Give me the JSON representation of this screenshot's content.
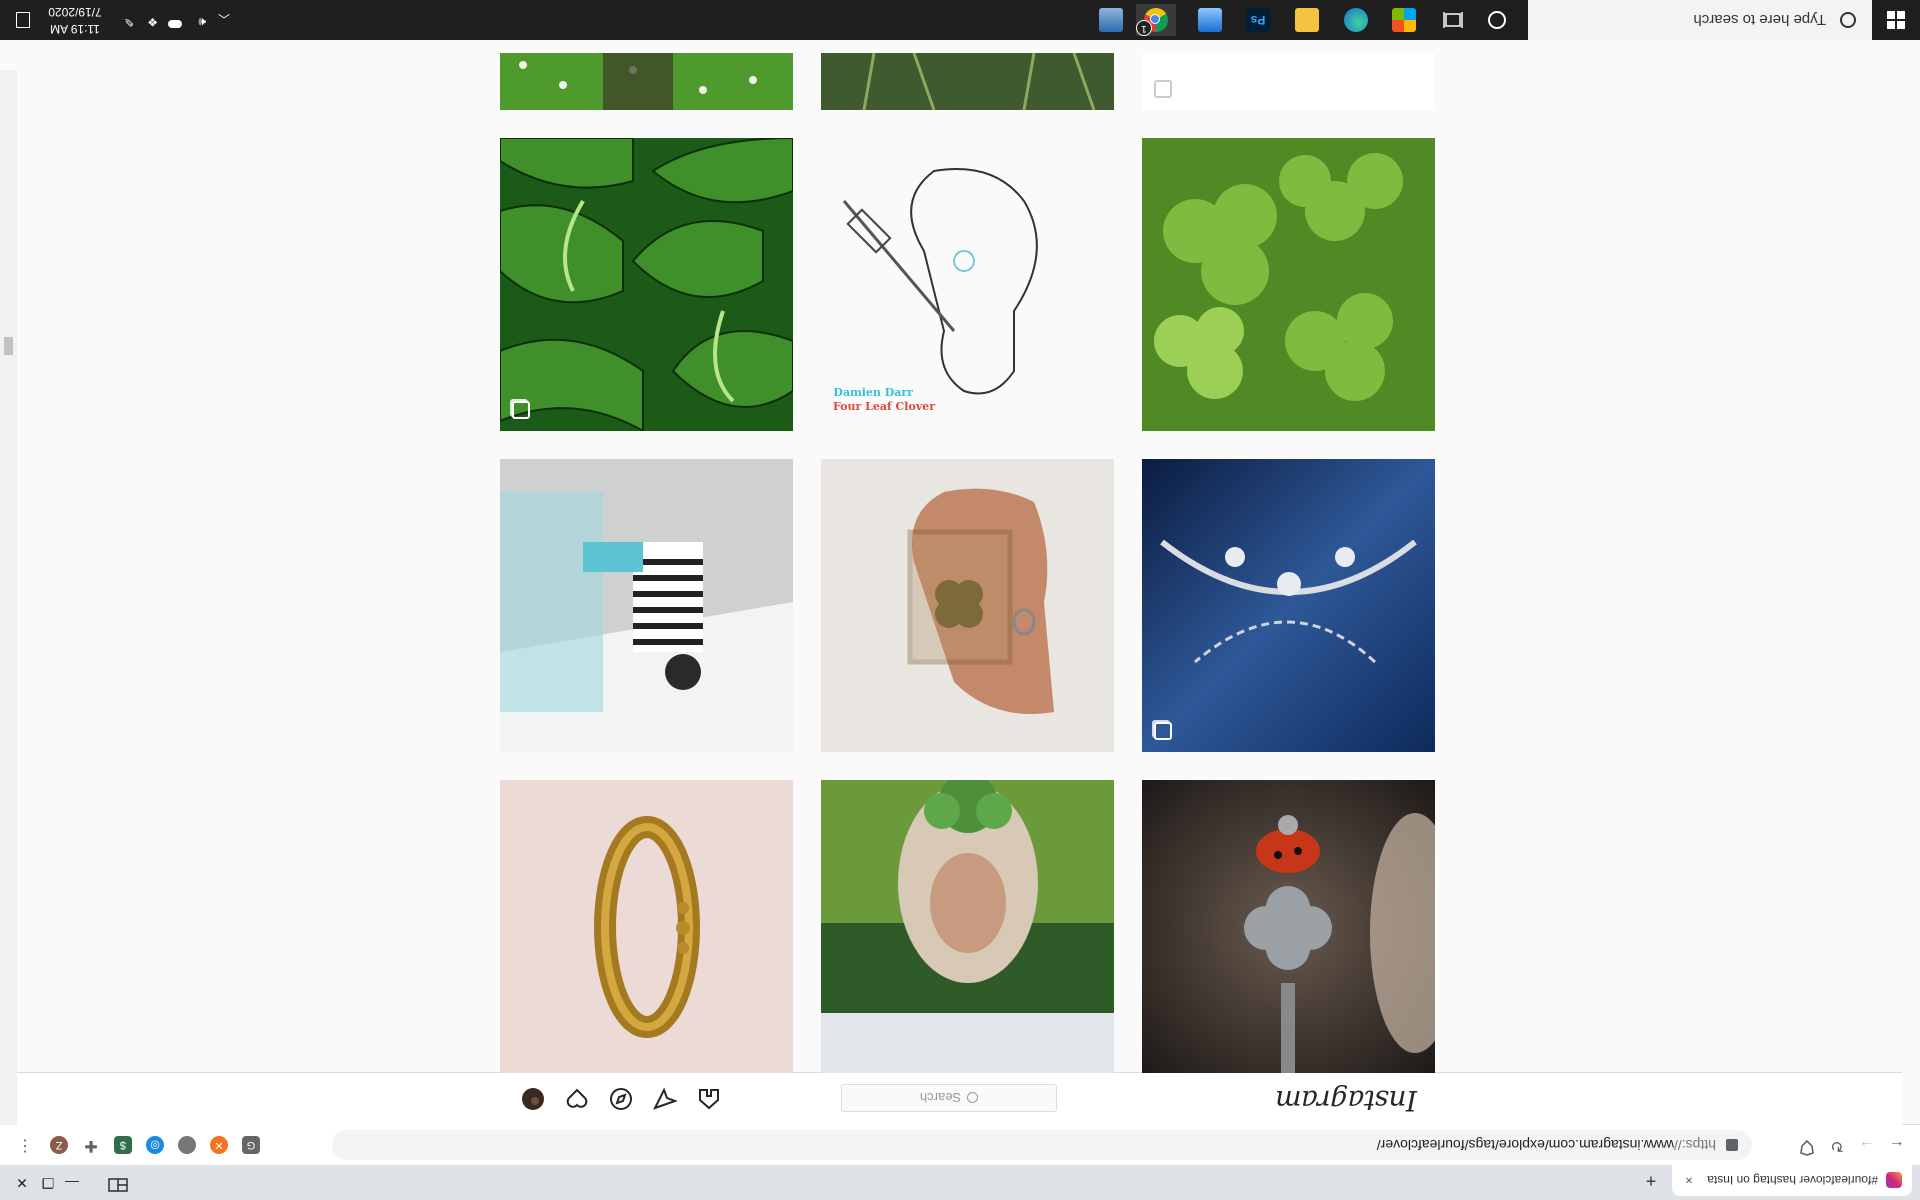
{
  "browser": {
    "tab_title": "#fourleafclover hashtag on Insta",
    "tab_close": "×",
    "new_tab": "+",
    "url_prefix": "https://",
    "url_rest": "www.instagram.com/explore/tags/fourleafclover/",
    "ext_badge_z": "Z"
  },
  "instagram": {
    "logo": "Instagram",
    "search_placeholder": "Search"
  },
  "taskbar": {
    "search_placeholder": "Type here to search",
    "time": "11:19 AM",
    "date": "7/19/2020",
    "ps_label": "Ps",
    "notification_badge": "1"
  },
  "colors": {
    "taskbar_bg": "#1f1f1f",
    "instagram_border": "#dbdbdb",
    "chrome_tabstrip": "#dee1e6"
  },
  "tiles": [
    {
      "name": "tile-ladybug-clover-ring",
      "multi": false
    },
    {
      "name": "tile-person-clover-crown",
      "multi": false
    },
    {
      "name": "tile-gold-ring",
      "multi": false
    },
    {
      "name": "tile-silver-clover-bracelet",
      "multi": true
    },
    {
      "name": "tile-framed-four-leaf-clover",
      "multi": false
    },
    {
      "name": "tile-striped-shirt-person",
      "multi": false
    },
    {
      "name": "tile-clover-leaves-photo",
      "multi": false
    },
    {
      "name": "tile-four-leaf-clover-line-art",
      "multi": false,
      "caption_1": "Four Leaf Clover",
      "caption_2": "Damien Darr"
    },
    {
      "name": "tile-green-clover-pattern",
      "multi": true
    },
    {
      "name": "tile-partial-white",
      "multi": true
    },
    {
      "name": "tile-partial-grass",
      "multi": false
    },
    {
      "name": "tile-partial-flowers",
      "multi": false
    }
  ]
}
